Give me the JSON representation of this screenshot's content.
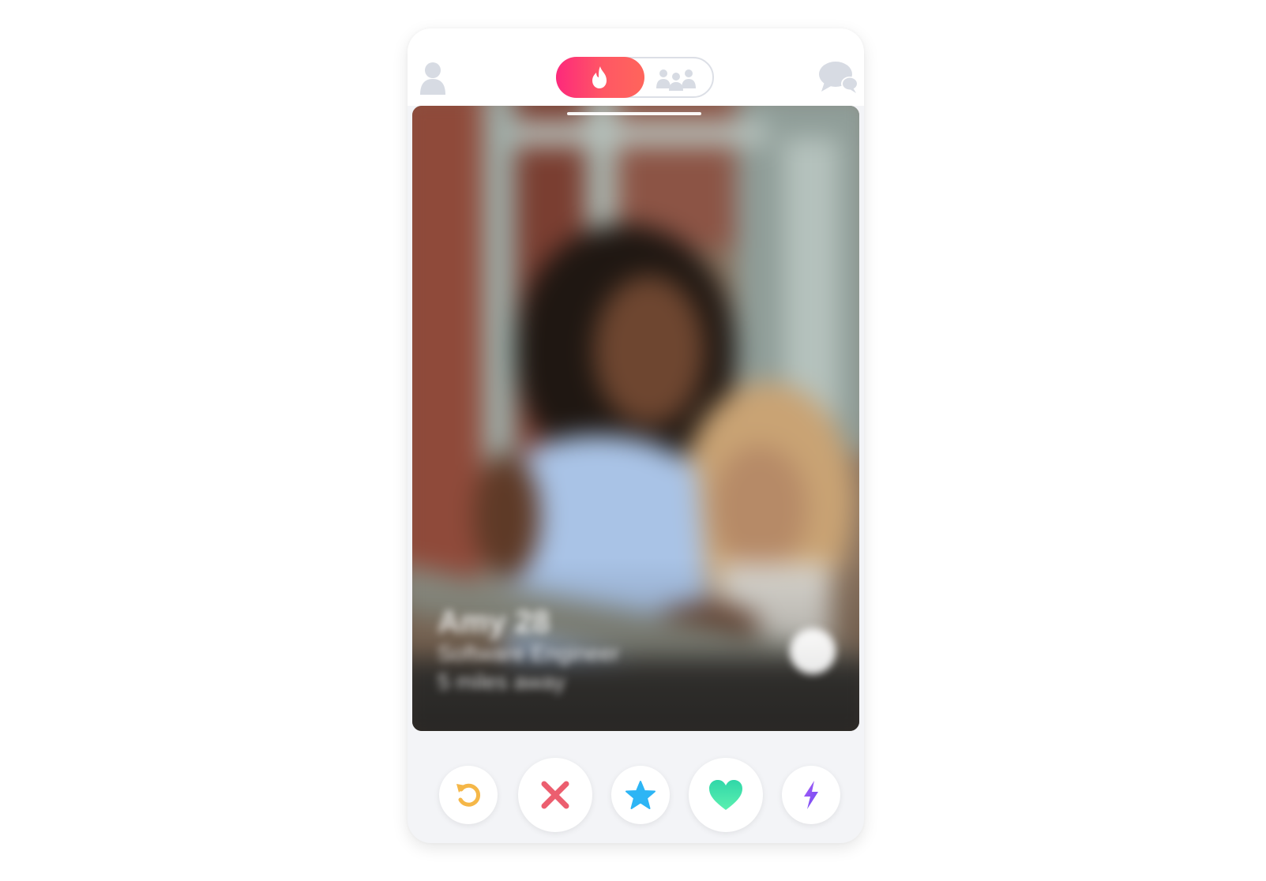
{
  "colors": {
    "brand_gradient": [
      "#fd297b",
      "#ff5864",
      "#ff655b"
    ],
    "inactive_icon": "#d7dbe3",
    "rewind": "#f5b748",
    "nope": "#ec5e6f",
    "super_like": "#2db5f5",
    "like": "#3ee0a8",
    "boost": "#8c53f5"
  },
  "header": {
    "left_icon": "profile-icon",
    "right_icon": "messages-icon",
    "mode_toggle": {
      "options": [
        {
          "icon": "flame-icon",
          "active": true
        },
        {
          "icon": "group-icon",
          "active": false
        }
      ]
    }
  },
  "card": {
    "photo_blurred": true,
    "photo_count_shown": 1,
    "name_line": "Amy 28",
    "detail_lines": [
      "Software Engineer",
      "5 miles away"
    ]
  },
  "actions": [
    {
      "name": "rewind",
      "icon": "rewind-icon"
    },
    {
      "name": "nope",
      "icon": "close-icon"
    },
    {
      "name": "super-like",
      "icon": "star-icon"
    },
    {
      "name": "like",
      "icon": "heart-icon"
    },
    {
      "name": "boost",
      "icon": "bolt-icon"
    }
  ]
}
